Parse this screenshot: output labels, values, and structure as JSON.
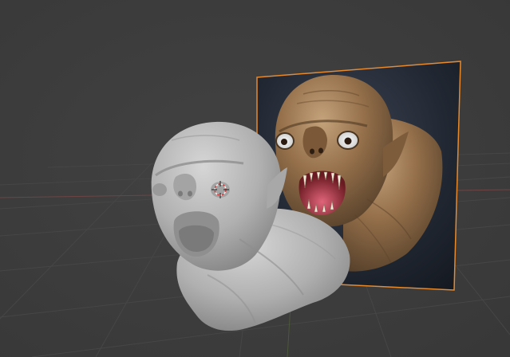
{
  "app": {
    "view": "3d-viewport"
  },
  "colors": {
    "background": "#3d3d3d",
    "grid_line": "#474747",
    "axis_x": "#7a4a4a",
    "axis_y": "#5a6e3c",
    "selection_outline": "#e8892b",
    "reference_backdrop": "#1d2430",
    "sculpt_clay": "#b8b8b8",
    "textured_skin": "#8a6a48",
    "mouth_interior": "#c8465a"
  },
  "scene": {
    "objects": [
      {
        "name": "image-reference-plane",
        "selected": true
      },
      {
        "name": "sculpt-mesh",
        "selected": false
      },
      {
        "name": "3d-cursor",
        "selected": false
      }
    ]
  }
}
